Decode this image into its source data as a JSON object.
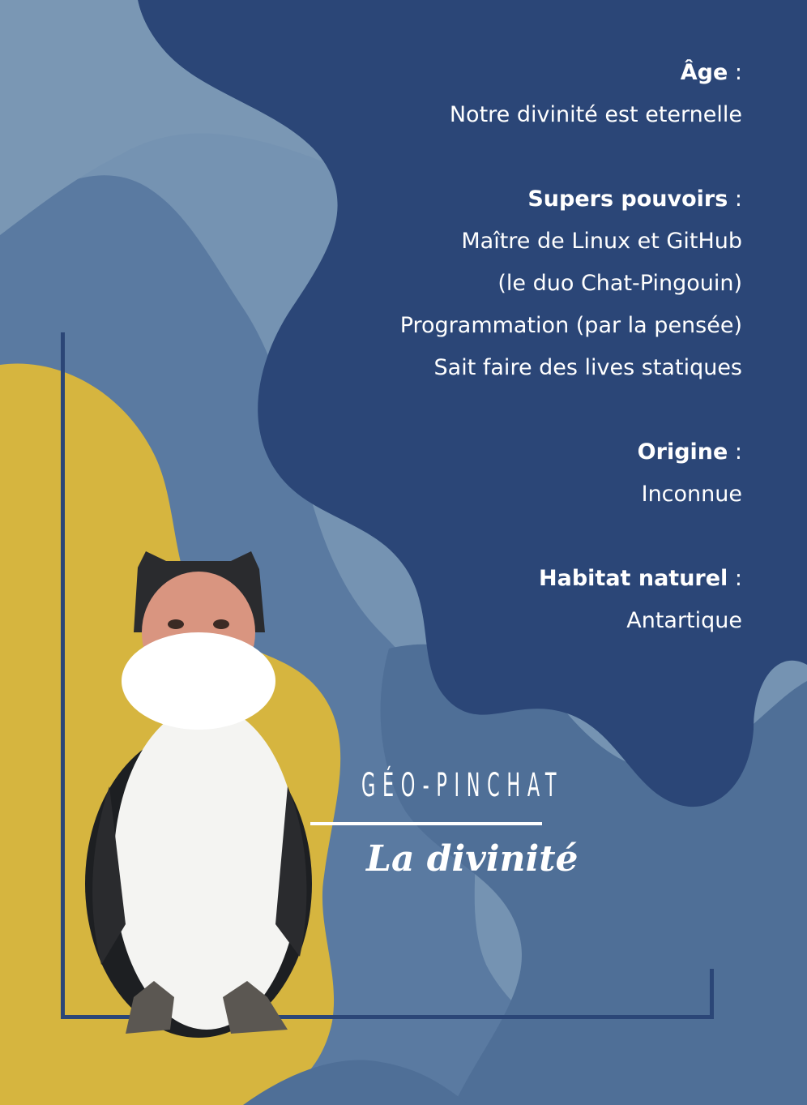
{
  "info": {
    "age": {
      "heading": "Âge",
      "colon": " :",
      "lines": [
        "Notre divinité est eternelle"
      ]
    },
    "powers": {
      "heading": "Supers pouvoirs",
      "colon": " :",
      "lines": [
        "Maître de Linux et GitHub",
        "(le duo Chat-Pingouin)",
        "Programmation (par la pensée)",
        "Sait faire des lives statiques"
      ]
    },
    "origin": {
      "heading": "Origine",
      "colon": " :",
      "lines": [
        "Inconnue"
      ]
    },
    "habitat": {
      "heading": "Habitat naturel",
      "colon": " :",
      "lines": [
        "Antartique"
      ]
    }
  },
  "title": {
    "name": "GÉO-PINCHAT",
    "subtitle": "La divinité"
  },
  "colors": {
    "navy": "#2b4677",
    "mid_blue": "#55749a",
    "light_blue": "#7593b2",
    "yellow": "#d6b53f",
    "text": "#ffffff"
  }
}
